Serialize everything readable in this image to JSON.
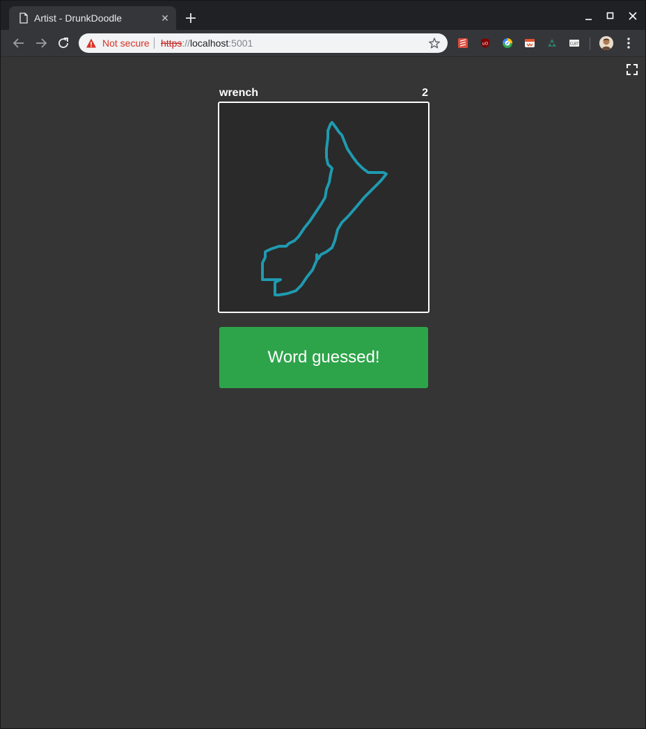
{
  "tab": {
    "title": "Artist - DrunkDoodle",
    "close_glyph": "✕"
  },
  "omnibox": {
    "security_label": "Not secure",
    "url_scheme": "https",
    "url_separator": "://",
    "url_host": "localhost",
    "url_port": ":5001"
  },
  "extensions": [
    "todoist-icon",
    "ublock-icon",
    "chrome-remote-icon",
    "wappalyzer-icon",
    "recycle-icon",
    "clipboard-icon"
  ],
  "game": {
    "word": "wrench",
    "score": "2",
    "stroke_color": "#1f9ab0",
    "guess_button_label": "Word guessed!",
    "guess_button_color": "#2ea44a"
  }
}
